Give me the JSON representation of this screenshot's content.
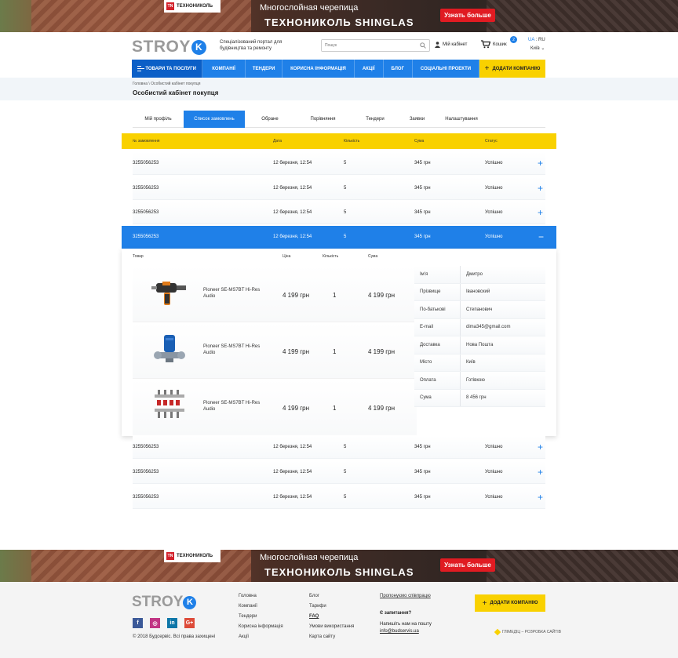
{
  "banner": {
    "brand_tn": "TN",
    "brand": "ТЕХНОНИКОЛЬ",
    "line1": "Многослойная черепица",
    "line2": "ТЕХНОНИКОЛЬ SHINGLAS",
    "cta": "Узнать больше"
  },
  "header": {
    "logo_text": "STROY",
    "logo_mark": "K",
    "tagline": "Спеціалізований портал для будівництва та ремонту",
    "search_placeholder": "Пошук",
    "cabinet": "Мій кабінет",
    "cart": "Кошик",
    "cart_count": "2",
    "lang_ua": "UA",
    "lang_sep": " : ",
    "lang_ru": "RU",
    "city": "Київ"
  },
  "nav": {
    "items": [
      "ТОВАРИ ТА ПОСЛУГИ",
      "КОМПАНІЇ",
      "ТЕНДЕРИ",
      "КОРИСНА ІНФОРМАЦІЯ",
      "АКЦІЇ",
      "БЛОГ",
      "СОЦІАЛЬНІ ПРОЕКТИ"
    ],
    "add_company": "ДОДАТИ КОМПАНІЮ"
  },
  "breadcrumb": "Головна \\ Особистий кабінет покупця",
  "page_title": "Особистий кабінет покупця",
  "tabs": [
    "Мій профіль",
    "Список замовлень",
    "Обране",
    "Порівняння",
    "Тендери",
    "Заявки",
    "Налаштування"
  ],
  "orders": {
    "headers": [
      "№ замовлення",
      "Дата",
      "Кількість",
      "Сума",
      "Статус"
    ],
    "rows": [
      {
        "id": "3255056253",
        "date": "12 березня, 12:54",
        "qty": "5",
        "sum": "345 грн",
        "status": "Успішно"
      },
      {
        "id": "3255056253",
        "date": "12 березня, 12:54",
        "qty": "5",
        "sum": "345 грн",
        "status": "Успішно"
      },
      {
        "id": "3255056253",
        "date": "12 березня, 12:54",
        "qty": "5",
        "sum": "345 грн",
        "status": "Успішно"
      },
      {
        "id": "3255056253",
        "date": "12 березня, 12:54",
        "qty": "5",
        "sum": "345 грн",
        "status": "Успішно"
      },
      {
        "id": "3255056253",
        "date": "12 березня, 12:54",
        "qty": "5",
        "sum": "345 грн",
        "status": "Успішно"
      },
      {
        "id": "3255056253",
        "date": "12 березня, 12:54",
        "qty": "5",
        "sum": "345 грн",
        "status": "Успішно"
      },
      {
        "id": "3255056253",
        "date": "12 березня, 12:54",
        "qty": "5",
        "sum": "345 грн",
        "status": "Успішно"
      }
    ],
    "expand_icon": "+",
    "collapse_icon": "−"
  },
  "detail": {
    "headers": [
      "Товар",
      "Ціна",
      "Кількість",
      "Сума"
    ],
    "products": [
      {
        "name": "Pioneer SE-MS7BT Hi-Res Audio",
        "price": "4 199 грн",
        "qty": "1",
        "sum": "4 199 грн",
        "icon": "hammer-drill"
      },
      {
        "name": "Pioneer SE-MS7BT Hi-Res Audio",
        "price": "4 199 грн",
        "qty": "1",
        "sum": "4 199 грн",
        "icon": "water-pump"
      },
      {
        "name": "Pioneer SE-MS7BT Hi-Res Audio",
        "price": "4 199 грн",
        "qty": "1",
        "sum": "4 199 грн",
        "icon": "manifold"
      }
    ],
    "info": [
      {
        "k": "Ім'я",
        "v": "Дмитро"
      },
      {
        "k": "Прізвище",
        "v": "Івановский"
      },
      {
        "k": "По-батькові",
        "v": "Степанович"
      },
      {
        "k": "E-mail",
        "v": "dima345@gmail.com"
      },
      {
        "k": "Доставка",
        "v": "Нова Пошта"
      },
      {
        "k": "Місто",
        "v": "Київ"
      },
      {
        "k": "Оплата",
        "v": "Готівкою"
      },
      {
        "k": "Сума",
        "v": "8 456 грн"
      }
    ]
  },
  "footer": {
    "logo_text": "STROY",
    "logo_mark": "K",
    "social": [
      "f",
      "◎",
      "in",
      "G+"
    ],
    "social_colors": [
      "#3b5998",
      "#c13584",
      "#0e76a8",
      "#dd4b39"
    ],
    "copyright": "© 2018 Будсервіс. Всі права захищені",
    "col1": [
      "Головна",
      "Компанії",
      "Тендери",
      "Корисна інформація",
      "Акції"
    ],
    "col2": [
      "Блог",
      "Тарифи",
      "FAQ",
      "Умови використання",
      "Карта сайту"
    ],
    "proposal": "Пропонуємо співпрацю",
    "question": "Є запитання?",
    "mail_text": "Напишіть нам на пошту",
    "mail": "info@budservis.ua",
    "add_company": "ДОДАТИ КОМПАНІЮ",
    "developer": "ГЛІМЕДІЦ – РОЗРОБКА САЙТІВ"
  },
  "colors": {
    "accent": "#1f80e8",
    "yellow": "#f9d100"
  }
}
